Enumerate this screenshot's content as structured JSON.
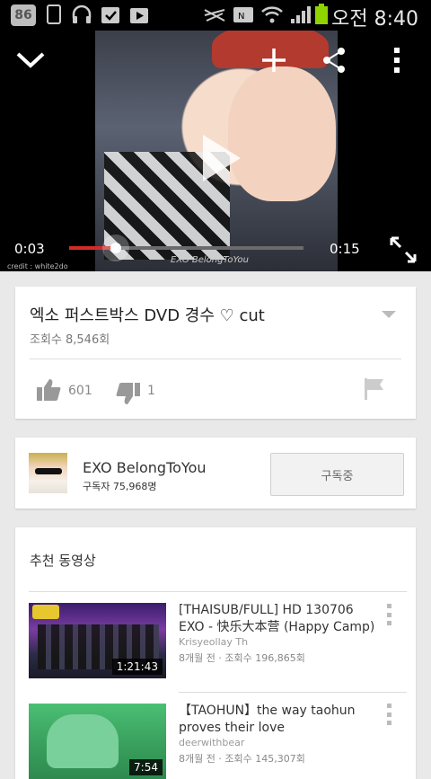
{
  "status_bar": {
    "badge": "86",
    "time": "오전 8:40"
  },
  "player": {
    "current_time": "0:03",
    "duration": "0:15",
    "progress": 0.2,
    "watermark": "EXO BelongToYou",
    "credit": "credit : white2do"
  },
  "video_info": {
    "title": "엑소 퍼스트박스 DVD 경수 ♡ cut",
    "views": "조회수 8,546회",
    "likes": "601",
    "dislikes": "1"
  },
  "channel": {
    "name": "EXO BelongToYou",
    "subscribers": "구독자 75,968명",
    "subscribe_label": "구독중"
  },
  "recommended": {
    "heading": "추천 동영상",
    "items": [
      {
        "title": "[THAISUB/FULL] HD 130706 EXO - 快乐大本营 (Happy Camp)",
        "channel": "Krisyeollay Th",
        "meta": "8개월 전 · 조회수 196,865회",
        "duration": "1:21:43"
      },
      {
        "title": "【TAOHUN】the way taohun proves their love",
        "channel": "deerwithbear",
        "meta": "8개월 전 · 조회수 145,307회",
        "duration": "7:54"
      }
    ]
  },
  "colors": {
    "accent_red": "#d32a2a",
    "progress_track": "#6b6b6b"
  }
}
